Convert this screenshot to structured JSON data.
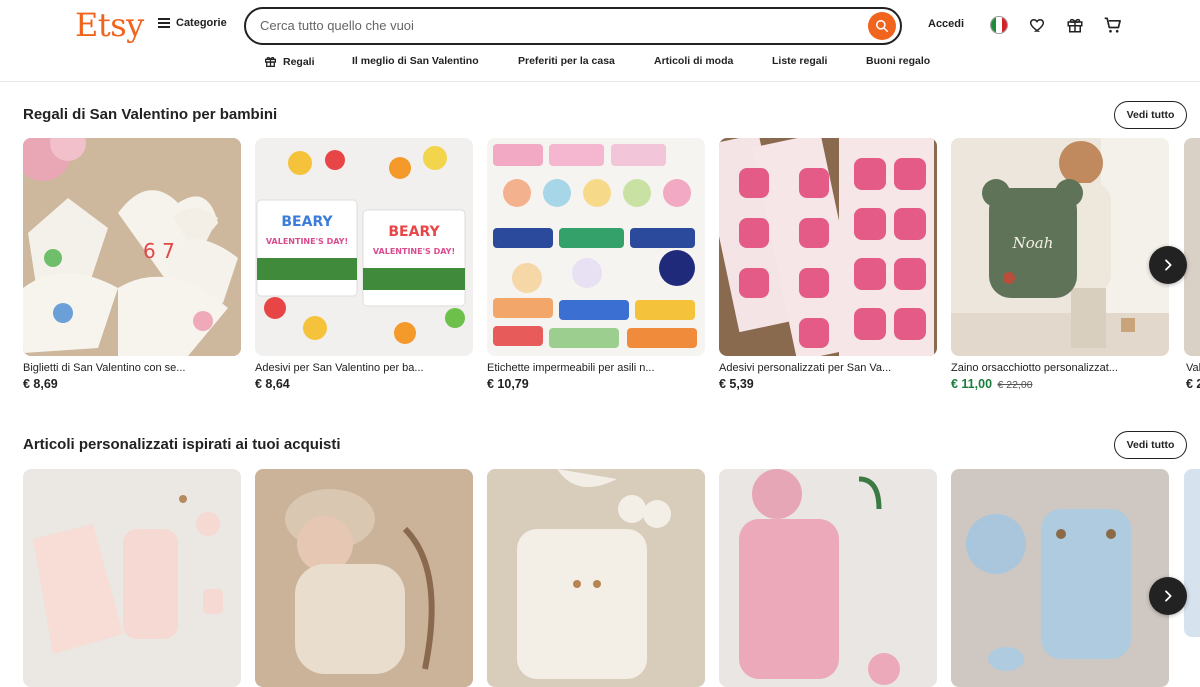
{
  "header": {
    "logo": "Etsy",
    "categories_label": "Categorie",
    "search_placeholder": "Cerca tutto quello che vuoi",
    "signin_label": "Accedi"
  },
  "subnav": {
    "items": [
      {
        "label": "Regali"
      },
      {
        "label": "Il meglio di San Valentino"
      },
      {
        "label": "Preferiti per la casa"
      },
      {
        "label": "Articoli di moda"
      },
      {
        "label": "Liste regali"
      },
      {
        "label": "Buoni regalo"
      }
    ]
  },
  "sections": [
    {
      "title": "Regali di San Valentino per bambini",
      "see_all": "Vedi tutto",
      "products": [
        {
          "title": "Biglietti di San Valentino con se...",
          "price": "€ 8,69"
        },
        {
          "title": "Adesivi per San Valentino per ba...",
          "price": "€ 8,64"
        },
        {
          "title": "Etichette impermeabili per asili n...",
          "price": "€ 10,79"
        },
        {
          "title": "Adesivi personalizzati per San Va...",
          "price": "€ 5,39"
        },
        {
          "title": "Zaino orsacchiotto personalizzat...",
          "price": "€ 11,00",
          "original_price": "€ 22,00"
        }
      ],
      "partial": {
        "title": "Val",
        "price": "€ 2"
      }
    },
    {
      "title": "Articoli personalizzati ispirati ai tuoi acquisti",
      "see_all": "Vedi tutto"
    }
  ],
  "colors": {
    "brand": "#f1641e",
    "sale": "#1a7d3b"
  }
}
